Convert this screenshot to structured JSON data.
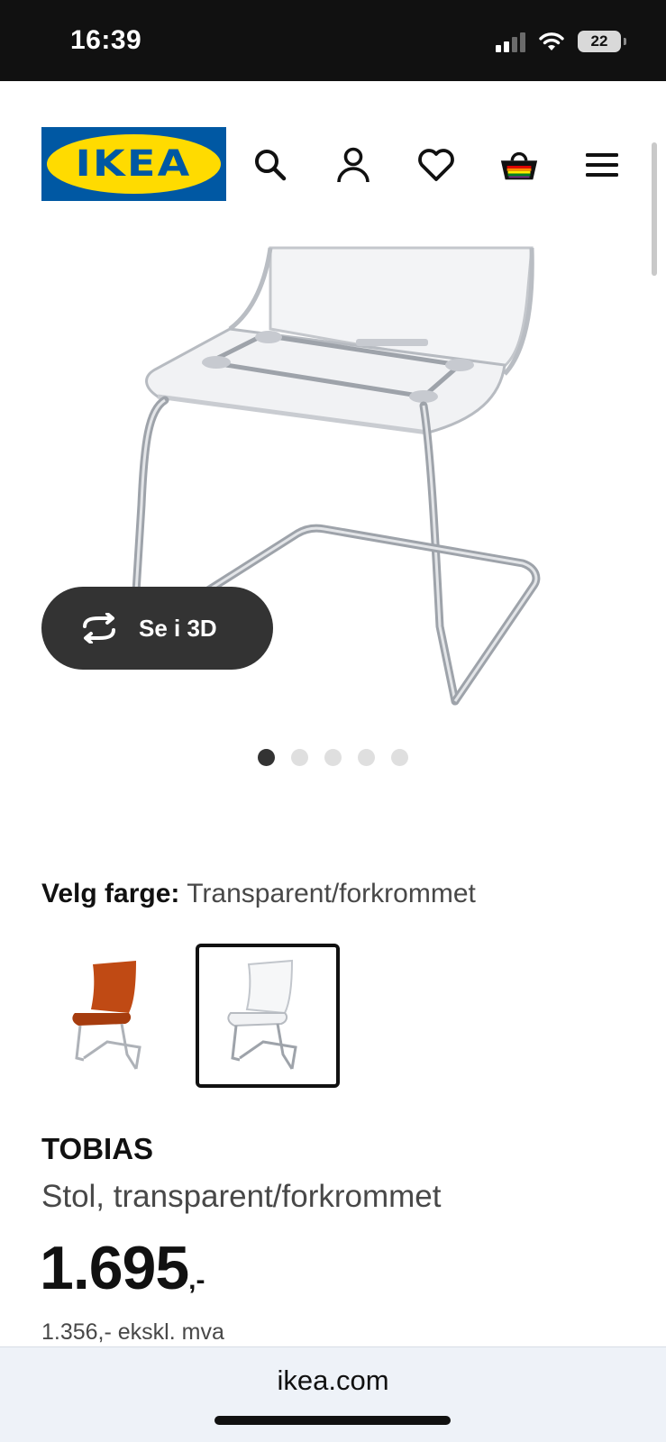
{
  "status_bar": {
    "time": "16:39",
    "battery": "22",
    "icons": [
      "cellular-signal-icon",
      "wifi-icon",
      "battery-icon"
    ]
  },
  "header": {
    "logo_text": "IKEA",
    "brand_colors": {
      "blue": "#0058a3",
      "yellow": "#ffdb00"
    },
    "icons": [
      "search-icon",
      "account-icon",
      "wishlist-heart-icon",
      "shopping-bag-icon",
      "menu-icon"
    ]
  },
  "product_gallery": {
    "view_3d_label": "Se i 3D",
    "dot_count": 5,
    "active_dot_index": 0
  },
  "color_picker": {
    "label": "Velg farge:",
    "value": "Transparent/forkrommet",
    "options": [
      {
        "color": "#c04a14",
        "selected": false
      },
      {
        "color": "transparent",
        "selected": true
      }
    ]
  },
  "product": {
    "name": "TOBIAS",
    "description": "Stol, transparent/forkrommet",
    "price_main": "1.695",
    "price_suffix": ",-",
    "price_ex_vat": "1.356,- ekskl. mva"
  },
  "browser": {
    "url": "ikea.com"
  }
}
